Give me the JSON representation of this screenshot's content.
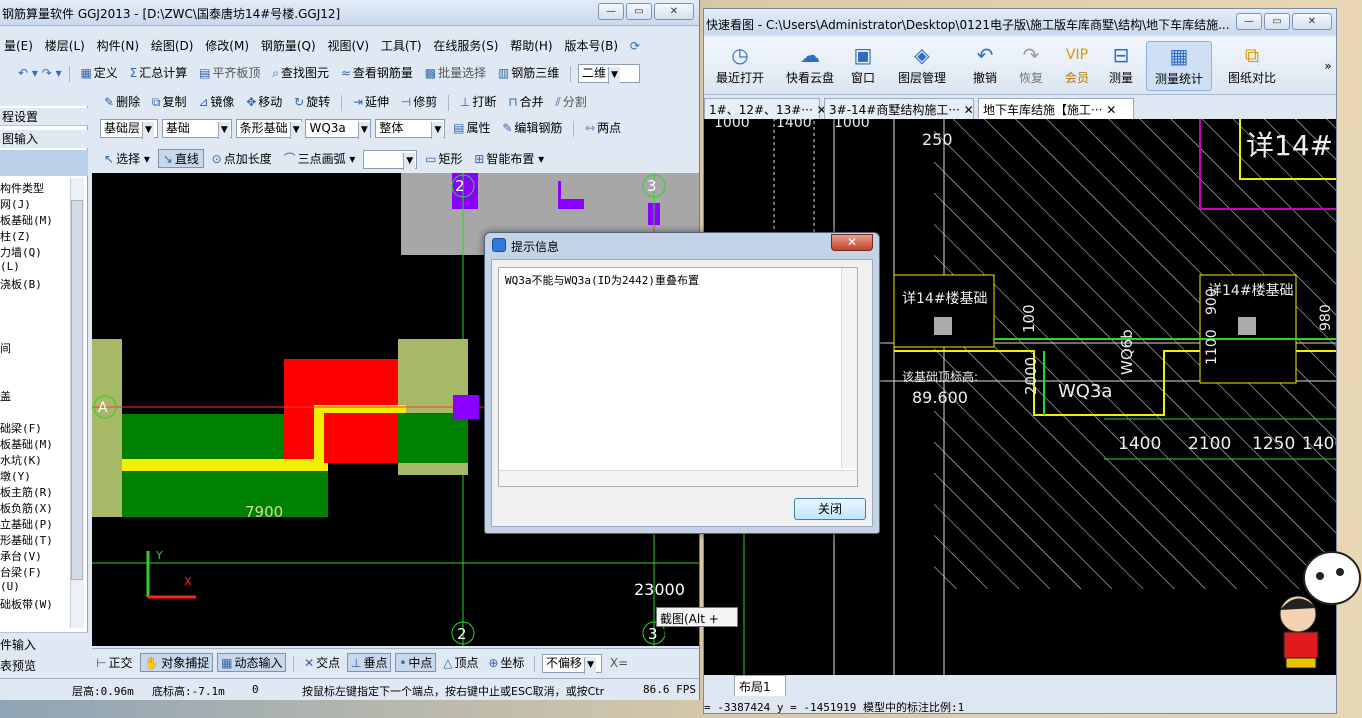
{
  "left_window": {
    "title": "钢筋算量软件 GGJ2013 - [D:\\ZWC\\国泰唐坊14#号楼.GGJ12]",
    "menu": [
      "量(E)",
      "楼层(L)",
      "构件(N)",
      "绘图(D)",
      "修改(M)",
      "钢筋量(Q)",
      "视图(V)",
      "工具(T)",
      "在线服务(S)",
      "帮助(H)",
      "版本号(B)"
    ],
    "toolbar1": {
      "define": "定义",
      "sum": "汇总计算",
      "flat_top": "平齐板顶",
      "find": "查找图元",
      "view_rebar": "查看钢筋量",
      "batch_select": "批量选择",
      "rebar_3d": "钢筋三维",
      "view_mode": "二维"
    },
    "toolbar2": {
      "delete": "删除",
      "copy": "复制",
      "mirror": "镜像",
      "move": "移动",
      "rotate": "旋转",
      "extend": "延伸",
      "trim": "修剪",
      "break": "打断",
      "merge": "合并",
      "split": "分割"
    },
    "toolbar3": {
      "floor": "基础层",
      "category": "基础",
      "type": "条形基础",
      "item": "WQ3a",
      "whole": "整体",
      "properties": "属性",
      "edit_rebar": "编辑钢筋",
      "two_point": "两点"
    },
    "toolbar4": {
      "select": "选择",
      "line": "直线",
      "point_length": "点加长度",
      "arc": "三点画弧",
      "rect": "矩形",
      "smart": "智能布置"
    },
    "left_panel": {
      "header1": "程设置",
      "header2": "图输入",
      "items_top": [
        "构件类型",
        "网(J)",
        "板基础(M)",
        "柱(Z)",
        "力墙(Q)",
        "(L)",
        "浇板(B)"
      ],
      "items_mid": [
        "间",
        "盖"
      ],
      "items_bottom": [
        "础梁(F)",
        "板基础(M)",
        "水坑(K)",
        "墩(Y)",
        "板主筋(R)",
        "板负筋(X)",
        "立基础(P)",
        "形基础(T)",
        "承台(V)",
        "台梁(F)",
        "(U)",
        "础板带(W)"
      ],
      "bottom1": "件输入",
      "bottom2": "表预览"
    },
    "canvas": {
      "axis_labels": [
        "2",
        "3",
        "A",
        "2",
        "3"
      ],
      "dim_7900": "7900",
      "dim_23000": "23000",
      "coord_x": "X",
      "coord_y": "Y"
    },
    "snapbar": {
      "ortho": "正交",
      "snap": "对象捕捉",
      "dynamic": "动态输入",
      "intersect": "交点",
      "perp": "垂点",
      "mid": "中点",
      "vertex": "顶点",
      "coord": "坐标",
      "offset": "不偏移",
      "x_label": "X="
    },
    "status": {
      "floor_height": "层高:0.96m",
      "base_height": "底标高:-7.1m",
      "zero": "0",
      "hint": "按鼠标左键指定下一个端点，按右键中止或ESC取消，或按Ctr",
      "fps": "86.6 FPS"
    }
  },
  "dialog": {
    "title": "提示信息",
    "message": "WQ3a不能与WQ3a(ID为2442)重叠布置",
    "close_button": "关闭"
  },
  "right_window": {
    "title": "快速看图 - C:\\Users\\Administrator\\Desktop\\0121电子版\\施工版车库商墅\\结构\\地下车库结施...",
    "ribbon": [
      "最近打开",
      "快看云盘",
      "窗口",
      "图层管理",
      "撤销",
      "恢复",
      "会员",
      "测量",
      "测量统计",
      "图纸对比"
    ],
    "tabs": [
      "1#、12#、13#···",
      "3#-14#商墅结构施工···",
      "地下车库结施【施工···"
    ],
    "drawing": {
      "labels": [
        "1000",
        "1400",
        "1000",
        "250",
        "详14#楼基础",
        "详14#楼基础",
        "100",
        "2000",
        "WQ6b",
        "WQ3a",
        "1100",
        "900",
        "980",
        "该基础顶标高:",
        "89.600",
        "1400",
        "2100",
        "1250",
        "1400",
        "详14#"
      ]
    },
    "layout_tab": "布局1",
    "status": "= -3387424 y = -1451919 模型中的标注比例:1"
  },
  "tooltip": "截图(Alt + A)",
  "colors": {
    "title_bg": "#c8d8ec",
    "canvas_bg": "#000000",
    "dialog_bg": "#c4d3e6",
    "cad_bg": "#000000",
    "yellow": "#f0f000",
    "green": "#2bd42b"
  }
}
